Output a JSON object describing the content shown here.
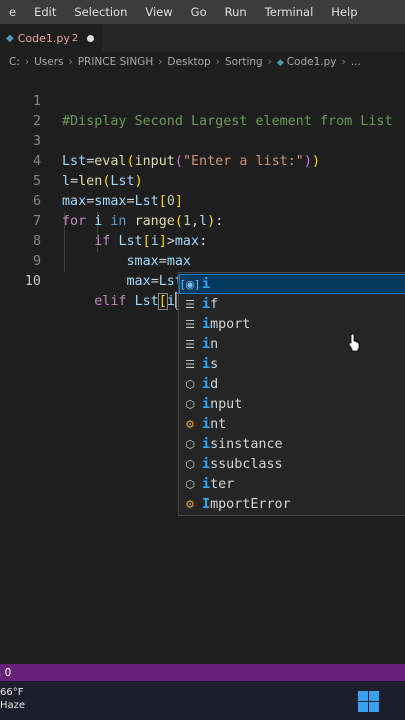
{
  "menu": [
    "e",
    "Edit",
    "Selection",
    "View",
    "Go",
    "Run",
    "Terminal",
    "Help"
  ],
  "tab": {
    "file_name": "Code1.py",
    "problems": "2"
  },
  "breadcrumb": [
    "C:",
    "Users",
    "PRINCE SINGH",
    "Desktop",
    "Sorting",
    "Code1.py",
    "..."
  ],
  "editor": {
    "lines": [
      {
        "n": "1",
        "text": "#Display Second Largest element from List"
      },
      {
        "n": "2",
        "text": ""
      },
      {
        "n": "3",
        "text": "Lst=eval(input(\"Enter a list:\"))"
      },
      {
        "n": "4",
        "text": "l=len(Lst)"
      },
      {
        "n": "5",
        "text": "max=smax=Lst[0]"
      },
      {
        "n": "6",
        "text": "for i in range(1,l):"
      },
      {
        "n": "7",
        "text": "    if Lst[i]>max:"
      },
      {
        "n": "8",
        "text": "        smax=max"
      },
      {
        "n": "9",
        "text": "        max=Lst[i]"
      },
      {
        "n": "10",
        "text": "    elif Lst[i]"
      }
    ],
    "active_line": "10"
  },
  "suggestions": [
    {
      "match": "i",
      "rest": "",
      "kind": "variable",
      "selected": true
    },
    {
      "match": "i",
      "rest": "f",
      "kind": "keyword"
    },
    {
      "match": "i",
      "rest": "mport",
      "kind": "keyword"
    },
    {
      "match": "i",
      "rest": "n",
      "kind": "keyword"
    },
    {
      "match": "i",
      "rest": "s",
      "kind": "keyword"
    },
    {
      "match": "i",
      "rest": "d",
      "kind": "function"
    },
    {
      "match": "i",
      "rest": "nput",
      "kind": "function"
    },
    {
      "match": "i",
      "rest": "nt",
      "kind": "class"
    },
    {
      "match": "i",
      "rest": "sinstance",
      "kind": "function"
    },
    {
      "match": "i",
      "rest": "ssubclass",
      "kind": "function"
    },
    {
      "match": "i",
      "rest": "ter",
      "kind": "function"
    },
    {
      "match": "I",
      "rest": "mportError",
      "kind": "class"
    }
  ],
  "status": {
    "left": ", 0"
  },
  "taskbar": {
    "temp": "66°F",
    "condition": "Haze"
  },
  "colors": {
    "statusbar": "#68217a",
    "selection": "#04395e",
    "match": "#2aaaff"
  }
}
